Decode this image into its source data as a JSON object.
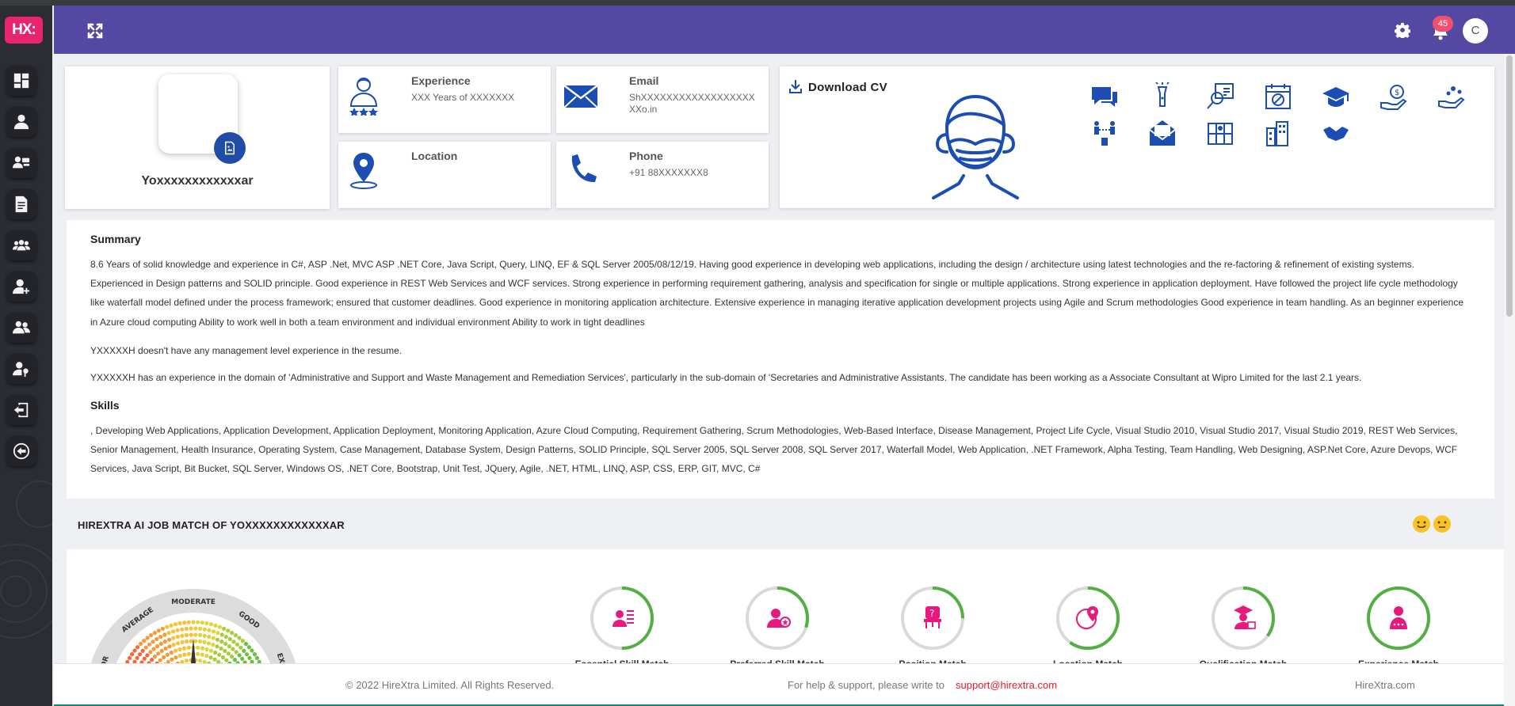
{
  "app": {
    "logo_text": "HX:",
    "brand_color": "#e8236f",
    "header_color": "#5548a3"
  },
  "header": {
    "notification_count": "45",
    "avatar_initial": "C"
  },
  "sidebar": {
    "items": [
      {
        "icon": "dashboard-icon"
      },
      {
        "icon": "user-icon"
      },
      {
        "icon": "candidates-icon"
      },
      {
        "icon": "document-icon"
      },
      {
        "icon": "team-icon"
      },
      {
        "icon": "add-user-icon"
      },
      {
        "icon": "users-icon"
      },
      {
        "icon": "user-key-icon"
      },
      {
        "icon": "logout-icon"
      },
      {
        "icon": "back-icon"
      }
    ]
  },
  "profile": {
    "name": "Yoxxxxxxxxxxxxar",
    "experience_title": "Experience",
    "experience_value": "XXX Years of XXXXXXX",
    "email_title": "Email",
    "email_value": "ShXXXXXXXXXXXXXXXXXXXXo.in",
    "location_title": "Location",
    "location_value": "",
    "phone_title": "Phone",
    "phone_value": "+91 88XXXXXXX8"
  },
  "cv": {
    "download_label": "Download CV",
    "icon_color": "#1b4db3",
    "feature_icons": [
      "chat-icon",
      "flashlight-icon",
      "search-report-icon",
      "calendar-icon",
      "graduation-cap-icon",
      "salary-hand-icon",
      "giving-hand-icon",
      "referral-icon",
      "mail-open-icon",
      "map-icon",
      "buildings-icon",
      "handshake-icon"
    ]
  },
  "summary": {
    "title": "Summary",
    "p1": "8.6 Years of solid knowledge and experience in C#, ASP .Net, MVC ASP .NET Core, Java Script, Query, LINQ, EF & SQL Server 2005/08/12/19. Having good experience in developing web applications, including the design / architecture using latest technologies and the re-factoring & refinement of existing systems. Experienced in Design patterns and SOLID principle. Good experience in REST Web Services and WCF services. Strong experience in performing requirement gathering, analysis and specification for single or multiple applications. Strong experience in application deployment. Have followed the project life cycle methodology like waterfall model defined under the process framework; ensured that customer deadlines. Good experience in monitoring application architecture. Extensive experience in managing iterative application development projects using Agile and Scrum methodologies Good experience in team handling. As an beginner experience in Azure cloud computing Ability to work well in both a team environment and individual environment Ability to work in tight deadlines",
    "p2": "YXXXXXH doesn't have any management level experience in the resume.",
    "p3": "YXXXXXH has an experience in the domain of 'Administrative and Support and Waste Management and Remediation Services', particularly in the sub-domain of 'Secretaries and Administrative Assistants. The candidate has been working as a Associate Consultant at Wipro Limited for the last 2.1 years."
  },
  "skills": {
    "title": "Skills",
    "text": ", Developing Web Applications, Application Development, Application Deployment, Monitoring Application, Azure Cloud Computing, Requirement Gathering, Scrum Methodologies, Web-Based Interface, Disease Management, Project Life Cycle, Visual Studio 2010, Visual Studio 2017, Visual Studio 2019, REST Web Services, Senior Management, Health Insurance, Operating System, Case Management, Database System, Design Patterns, SOLID Principle, SQL Server 2005, SQL Server 2008, SQL Server 2017, Waterfall Model, Web Application, .NET Framework, Alpha Testing, Team Handling, Web Designing, ASP.Net Core, Azure Devops, WCF Services, Java Script, Bit Bucket, SQL Server, Windows OS, .NET Core, Bootstrap, Unit Test, JQuery, Agile, .NET, HTML, LINQ, ASP, CSS, ERP, GIT, MVC, C#"
  },
  "job_match": {
    "title": "HIREXTRA AI JOB MATCH OF YOXXXXXXXXXXXXAR",
    "gauge_labels": [
      "POOR",
      "AVERAGE",
      "MODERATE",
      "GOOD",
      "EXCELL"
    ],
    "gauge_needle_fraction": 0.5,
    "metric_color": "#e8197d",
    "ring_color": "#52b043",
    "metrics": [
      {
        "icon": "essential-skill-icon",
        "fill": 0.5,
        "label": "Essential Skill Match"
      },
      {
        "icon": "preferred-skill-icon",
        "fill": 0.3,
        "label": "Preferred Skill Match"
      },
      {
        "icon": "position-icon",
        "fill": 0.25,
        "label": "Position Match"
      },
      {
        "icon": "location-match-icon",
        "fill": 0.6,
        "label": "Location Match"
      },
      {
        "icon": "qualification-icon",
        "fill": 0.35,
        "label": "Qualification Match"
      },
      {
        "icon": "experience-match-icon",
        "fill": 1.0,
        "label": "Experience Match"
      }
    ]
  },
  "footer": {
    "copyright": "© 2022 HireXtra Limited. All Rights Reserved.",
    "help_text": "For help & support, please write to",
    "support_email": "support@hirextra.com",
    "site": "HireXtra.com"
  }
}
